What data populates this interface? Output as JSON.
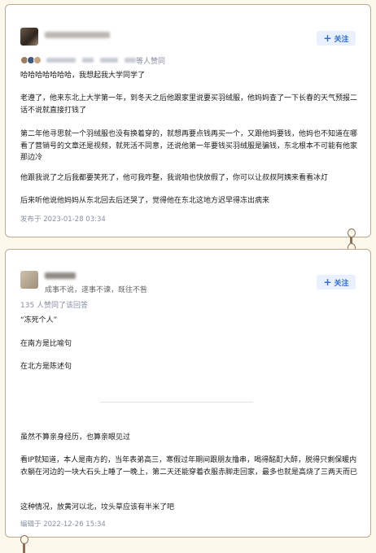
{
  "answer1": {
    "follow_label": "关注",
    "voters_suffix": "等人赞同",
    "paragraphs": [
      "哈哈哈哈哈哈哈，我想起我大学同学了",
      "老遵了，他来东北上大学第一年，到冬天之后他跟家里说要买羽绒服，他妈妈查了一下长春的天气预报二话不说就直接打钱了",
      "第二年他寻思就一个羽绒服也没有换着穿的，就想再要点钱再买一个，又跟他妈要钱，他妈也不知道在哪看了营销号的文章还是视频，就死活不同意，还说他第一年要钱买羽绒服是骗钱，东北根本不可能有他家那边冷",
      "他跟我说了之后我都要笑死了，他可我咋整，我说咱也快放假了，你可以让叔叔阿姨来看看冰灯",
      "后来听他说他妈妈从东北回去后还哭了，觉得他在东北这地方迟早得冻出病来"
    ],
    "date": "发布于 2023-01-28 03:34"
  },
  "answer2": {
    "bio": "成事不说，遂事不谏，既往不咎",
    "follow_label": "关注",
    "upvote_text": "135 人赞同了该回答",
    "paragraphs_top": [
      "“冻死个人”",
      "在南方是比喻句",
      "在北方是陈述句"
    ],
    "paragraphs_bottom": [
      "虽然不算亲身经历，也算亲眼见过",
      "看IP就知道，本人是南方的，当年表弟高三，寒假过年期间跟朋友撸串，喝得酩酊大醉，脱得只剩保暖内衣躺在河边的一块大石头上睡了一晚上，第二天还能穿着衣服赤脚走回家，最多也就是高烧了三两天而已",
      "这种情况，放黄河以北，坟头草应该有半米了吧"
    ],
    "date": "编辑于 2022-12-26 15:34"
  },
  "colors": {
    "page_bg": "#fdf8ec",
    "card_border": "#bfa98f",
    "accent": "#2f6fd6",
    "meta": "#8590a6"
  }
}
